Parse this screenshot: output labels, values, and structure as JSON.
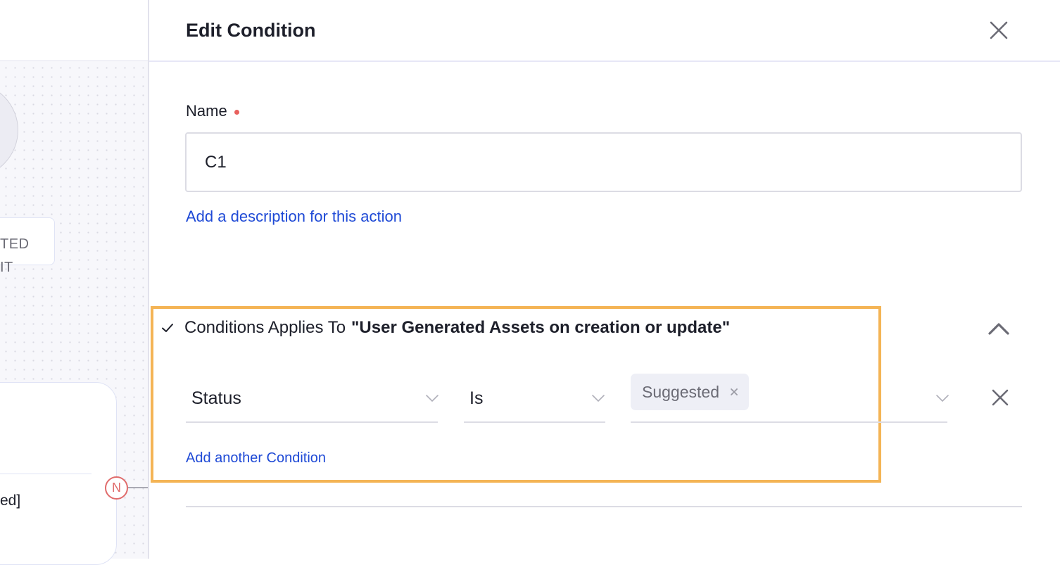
{
  "canvas": {
    "node_label_lines": [
      "TED",
      "IT"
    ],
    "node_card_text": "ed]",
    "branch_badge": "N"
  },
  "panel": {
    "title": "Edit Condition",
    "close_icon": "close-icon",
    "name_field": {
      "label": "Name",
      "required": true,
      "value": "C1"
    },
    "description_link": "Add a description for this action",
    "conditions": {
      "header_prefix": "Conditions Applies To",
      "header_target": "\"User Generated Assets on creation or update\"",
      "expanded": true,
      "rows": [
        {
          "field": "Status",
          "operator": "Is",
          "values": [
            "Suggested"
          ]
        }
      ],
      "add_link": "Add another Condition"
    }
  },
  "colors": {
    "accent_link": "#1f4ad6",
    "highlight_border": "#f4b455",
    "required_dot": "#e8605d",
    "badge": "#e06b6b"
  }
}
